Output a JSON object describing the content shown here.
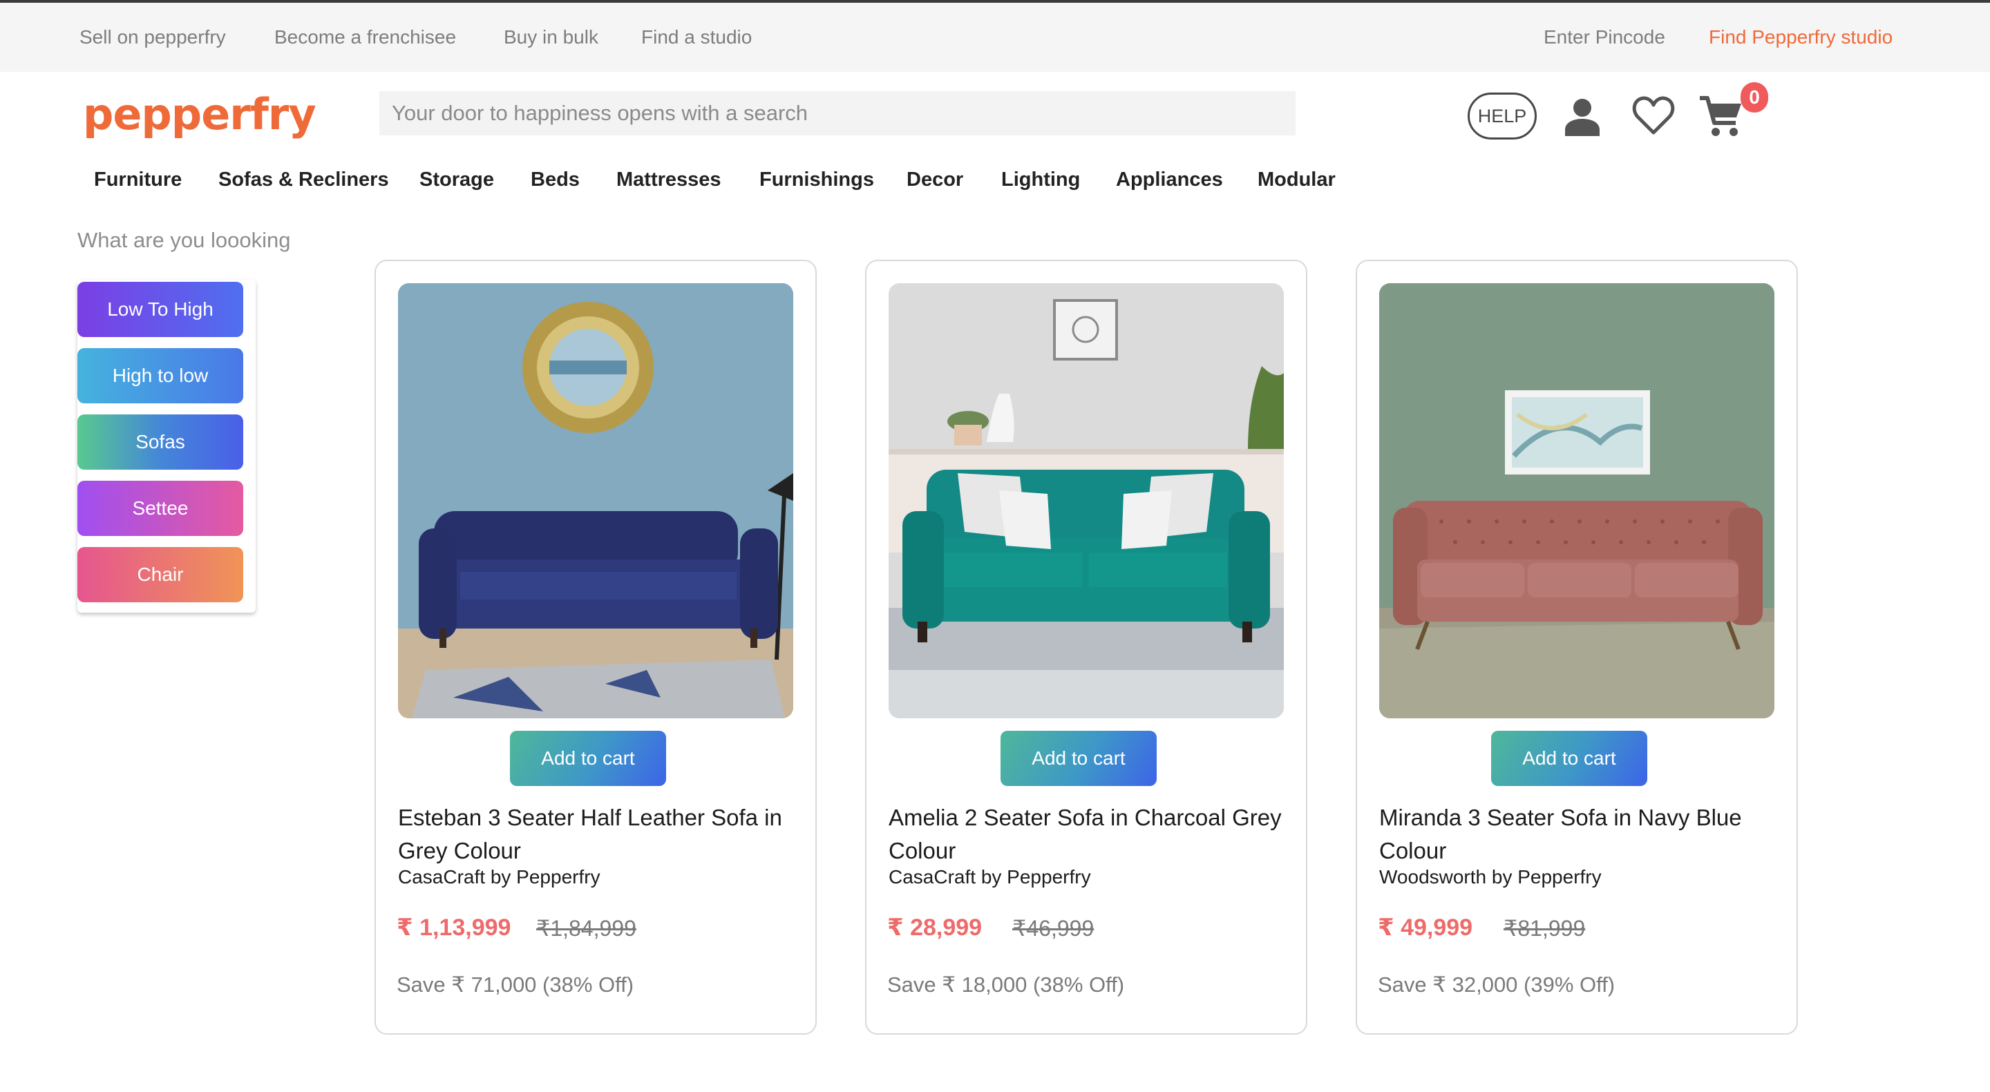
{
  "top_links": {
    "sell": "Sell on pepperfry",
    "franchisee": "Become a frenchisee",
    "bulk": "Buy in bulk",
    "studio": "Find a studio",
    "pincode": "Enter Pincode",
    "find_studio": "Find Pepperfry studio"
  },
  "header": {
    "logo": "pepperfry",
    "search_placeholder": "Your door to happiness opens with a search",
    "help": "HELP",
    "cart_count": "0",
    "icons": [
      "user-icon",
      "heart-icon",
      "cart-icon"
    ]
  },
  "nav": [
    "Furniture",
    "Sofas & Recliners",
    "Storage",
    "Beds",
    "Mattresses",
    "Furnishings",
    "Decor",
    "Lighting",
    "Appliances",
    "Modular"
  ],
  "sidebar": {
    "prompt": "What are you loooking",
    "filters": [
      "Low To High",
      "High to low",
      "Sofas",
      "Settee",
      "Chair"
    ]
  },
  "products": [
    {
      "name": "Esteban 3 Seater Half Leather Sofa in Grey Colour",
      "brand": "CasaCraft by Pepperfry",
      "price": "₹ 1,13,999",
      "mrp": "₹1,84,999",
      "save": "Save ₹ 71,000 (38% Off)",
      "button": "Add to cart"
    },
    {
      "name": "Amelia 2 Seater Sofa in Charcoal Grey Colour",
      "brand": "CasaCraft by Pepperfry",
      "price": "₹ 28,999",
      "mrp": "₹46,999",
      "save": "Save ₹ 18,000 (38% Off)",
      "button": "Add to cart"
    },
    {
      "name": "Miranda 3 Seater Sofa in Navy Blue Colour",
      "brand": "Woodsworth by Pepperfry",
      "price": "₹ 49,999",
      "mrp": "₹81,999",
      "save": "Save ₹ 32,000 (39% Off)",
      "button": "Add to cart"
    }
  ],
  "colors": {
    "brand": "#ef6a39",
    "price": "#ef6a6a",
    "badge": "#f05a5a"
  }
}
